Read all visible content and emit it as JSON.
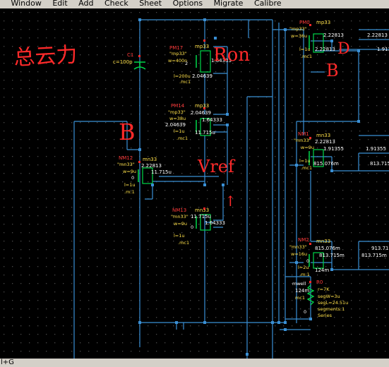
{
  "menu": [
    "gn",
    "Window",
    "Edit",
    "Add",
    "Check",
    "Sheet",
    "Options",
    "Migrate",
    "Calibre"
  ],
  "status": {
    "text": "l+G"
  },
  "colors": {
    "wire": "#3a8fd4",
    "instance_name": "#ff3b3b",
    "param": "#ffe14a",
    "net": "#ffffff",
    "ink": "#ff2a2a",
    "device": "#00d84a",
    "dot": "#555555"
  },
  "annotations": {
    "ohm_note": "总云力",
    "b_left": "B",
    "ron": "Ron",
    "vref": "Vref",
    "d_right": "D",
    "b_right": "B",
    "arrow": "↑"
  },
  "cap": {
    "name": "C1",
    "value": "c=100p"
  },
  "pm17": {
    "name": "PM17",
    "model": "\"mp33\"",
    "w": "w=400n",
    "l": "l=200u",
    "m": ".mc1",
    "sub": "mp33",
    "v1": "1.64333",
    "v2": "2.04639",
    "pin": "2"
  },
  "pm14": {
    "name": "PM14",
    "model": "\"mp33\"",
    "w": "w=38u",
    "l": "l=1u",
    "m": ".mc1",
    "sub": "mp33",
    "v1": "2.04639",
    "v2": "1.64333",
    "v3": "2.04639",
    "v4": "11.715u"
  },
  "nm12": {
    "name": "NM12",
    "model": "\"mn33\"",
    "w": "w=9u",
    "l": "l=1u",
    "m": ".m:1",
    "sub": "mn33",
    "v1": "2.22813",
    "v2": "11.715u",
    "b": "0"
  },
  "nm13": {
    "name": "NM13",
    "model": "\"mn33\"",
    "w": "w=9u",
    "l": "l=1u",
    "m": ".mc1",
    "sub": "mn33",
    "v1": "11.715u",
    "v2": "1.64333",
    "b": "0"
  },
  "pm0": {
    "name": "PM0",
    "model": "\"mp33\"",
    "w": "w=36u",
    "l": "l=1u",
    "m": ".mc1",
    "sub": "mp33",
    "v1": "2.22813",
    "v2": "2.22813",
    "v3": "2.22813",
    "v4": "1.913"
  },
  "nm1": {
    "name": "NM1",
    "model": "\"mn33\"",
    "w": "w=9u",
    "l": "l=1u",
    "m": ".mc1",
    "sub": "mn33",
    "v1": "2.22813",
    "v2": "1.91355",
    "v3": "1.91355",
    "v4": "815.076m",
    "v5": "813.715"
  },
  "nm2": {
    "name": "NM2",
    "model": "\"mn33\"",
    "w": "w=16u",
    "l": "l=2u",
    "m": ".m:1",
    "sub": "mn33",
    "v1": "815.076m",
    "v2": "813.715m",
    "v3": "913.71",
    "v4": "813.715m",
    "v5": "124m",
    "b": "0"
  },
  "r0": {
    "name": "R0",
    "r": "r=7K",
    "segW": "segW=3u",
    "segL": "segL=24.51u",
    "segs": "segments:1",
    "series": "Series",
    "model": "mwell",
    "v": "124m",
    "m": "mc1",
    "b": "0"
  }
}
